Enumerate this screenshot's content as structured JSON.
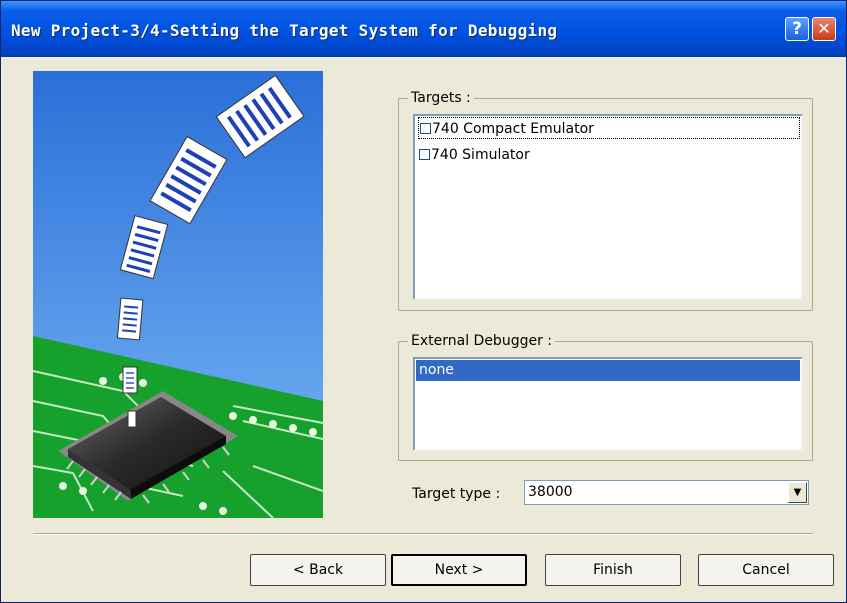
{
  "window": {
    "title": "New Project-3/4-Setting the Target System for Debugging",
    "help_glyph": "?",
    "close_glyph": "✕"
  },
  "targets": {
    "legend": "Targets :",
    "items": [
      {
        "label": "740 Compact Emulator",
        "checked": false,
        "focused": true
      },
      {
        "label": "740 Simulator",
        "checked": false,
        "focused": false
      }
    ]
  },
  "external_debugger": {
    "legend": "External Debugger :",
    "items": [
      {
        "label": "none",
        "selected": true
      }
    ]
  },
  "target_type": {
    "label": "Target type :",
    "value": "38000",
    "arrow_glyph": "▼"
  },
  "buttons": {
    "back": "< Back",
    "next": "Next >",
    "finish": "Finish",
    "cancel": "Cancel"
  },
  "icons": [
    "help-icon",
    "close-icon",
    "dropdown-arrow-icon"
  ],
  "colors": {
    "titlebar": "#0054e3",
    "selection": "#316ac5",
    "dialog_bg": "#ece9d8",
    "sky": "#4a90e8",
    "pcb_green": "#16a12c"
  }
}
